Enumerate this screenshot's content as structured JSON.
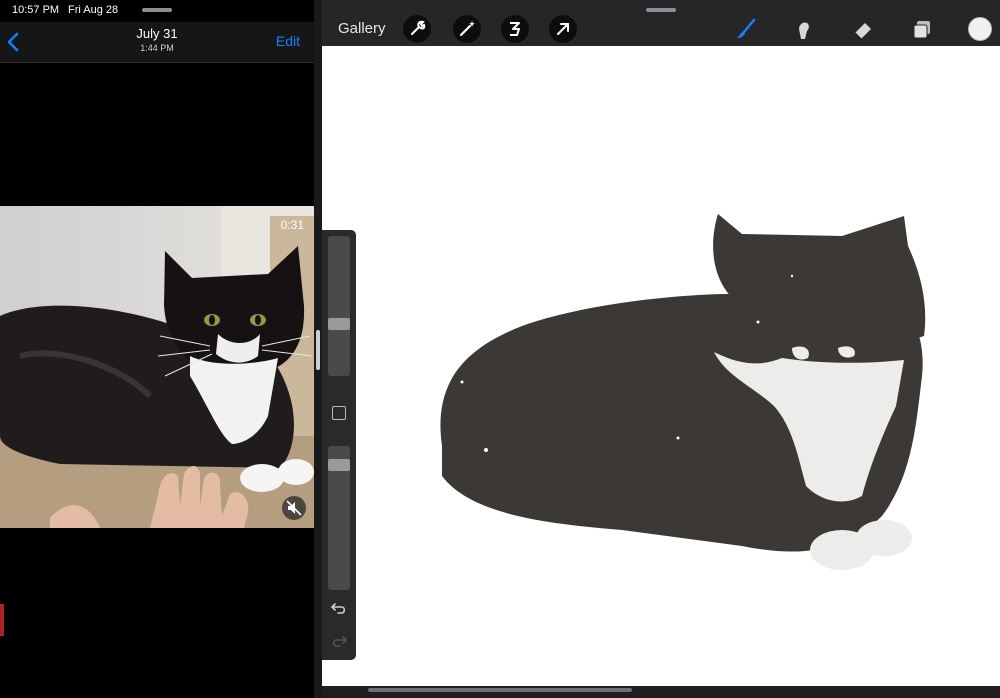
{
  "status_bar": {
    "time": "10:57 PM",
    "date": "Fri Aug 28"
  },
  "photos": {
    "title": "July 31",
    "subtitle": "1:44 PM",
    "edit_label": "Edit",
    "video_duration": "0:31"
  },
  "procreate": {
    "gallery_label": "Gallery",
    "tools": [
      "wrench-icon",
      "magic-wand-icon",
      "selection-icon",
      "transform-arrow-icon",
      "brush-icon",
      "smudge-icon",
      "eraser-icon",
      "layers-icon"
    ],
    "color": "#f0f0f0",
    "accent_color": "#1e7bff",
    "ink_color": "#3b3836",
    "brush_size_level": 0.36,
    "opacity_level": 0.9
  }
}
